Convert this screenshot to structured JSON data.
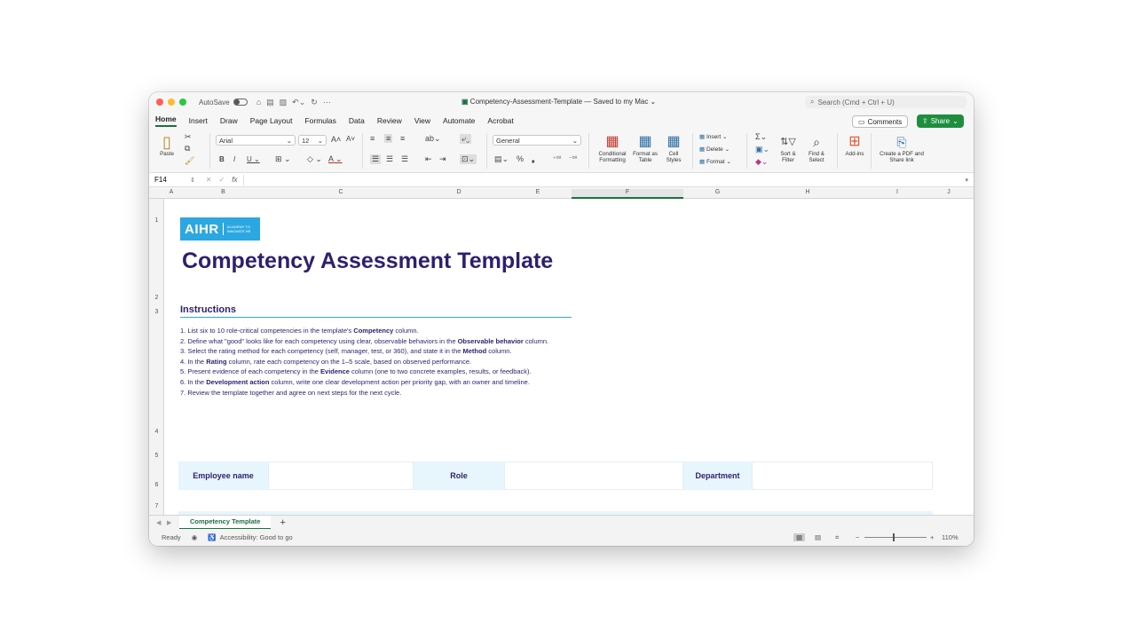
{
  "window": {
    "autosave_label": "AutoSave",
    "doc_title": "Competency-Assessment-Template — Saved to my Mac ⌄",
    "search_placeholder": "Search (Cmd + Ctrl + U)"
  },
  "menu": {
    "tabs": [
      "Home",
      "Insert",
      "Draw",
      "Page Layout",
      "Formulas",
      "Data",
      "Review",
      "View",
      "Automate",
      "Acrobat"
    ],
    "comments_label": "Comments",
    "share_label": "Share"
  },
  "ribbon": {
    "paste_label": "Paste",
    "font_name": "Arial",
    "font_size": "12",
    "number_format": "General",
    "conditional_formatting": "Conditional Formatting",
    "format_as_table": "Format as Table",
    "cell_styles": "Cell Styles",
    "insert": "Insert",
    "delete": "Delete",
    "format": "Format",
    "sort_filter": "Sort & Filter",
    "find_select": "Find & Select",
    "add_ins": "Add-ins",
    "create_pdf": "Create a PDF and Share link"
  },
  "formula_bar": {
    "cell_ref": "F14",
    "fx": "fx"
  },
  "columns": [
    "A",
    "B",
    "C",
    "D",
    "E",
    "F",
    "G",
    "H",
    "I",
    "J"
  ],
  "rows": [
    "1",
    "2",
    "3",
    "4",
    "5",
    "6",
    "7"
  ],
  "sheet": {
    "logo_main": "AIHR",
    "logo_sub_1": "ACADEMY TO",
    "logo_sub_2": "INNOVATE HR",
    "title": "Competency Assessment Template",
    "instructions_heading": "Instructions",
    "instructions": [
      {
        "pre": "1. List six to 10 role-critical competencies in the template's ",
        "bold": "Competency",
        "post": " column."
      },
      {
        "pre": "2. Define what \"good\" looks like for each competency using clear, observable behaviors in the ",
        "bold": "Observable behavior",
        "post": " column."
      },
      {
        "pre": "3. Select the rating method for each competency (self, manager, test, or 360), and state it in the ",
        "bold": "Method",
        "post": " column."
      },
      {
        "pre": "4. In the ",
        "bold": "Rating",
        "post": " column, rate each competency on the 1–5 scale, based on observed performance."
      },
      {
        "pre": "5. Present evidence of each competency in the ",
        "bold": "Evidence",
        "post": " column (one to two concrete examples, results, or feedback)."
      },
      {
        "pre": "6. In the ",
        "bold": "Development action",
        "post": " column, write one clear development action per priority gap, with an owner and timeline."
      },
      {
        "pre": "7. Review the template together and agree on next steps for the next cycle.",
        "bold": "",
        "post": ""
      }
    ],
    "employee_name_label": "Employee name",
    "role_label": "Role",
    "department_label": "Department"
  },
  "sheet_tabs": {
    "active": "Competency Template",
    "add": "+"
  },
  "status": {
    "ready": "Ready",
    "accessibility": "Accessibility: Good to go",
    "zoom": "110%"
  },
  "colors": {
    "accent_green": "#1d6f42",
    "title_purple": "#2e1f6e",
    "aihr_blue": "#2ba7e1",
    "label_fill": "#e7f5fc"
  }
}
